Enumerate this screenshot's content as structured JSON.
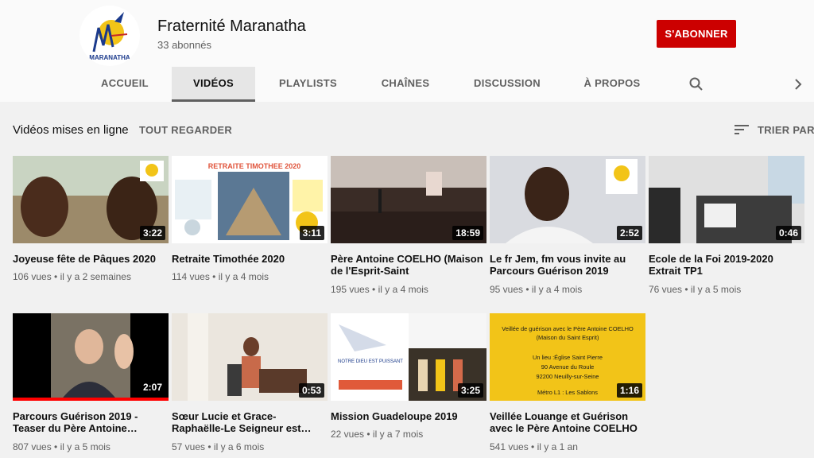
{
  "channel": {
    "name": "Fraternité Maranatha",
    "subscribers": "33 abonnés",
    "subscribe_label": "S'ABONNER",
    "logo_text": "MARANATHA"
  },
  "tabs": [
    {
      "label": "ACCUEIL"
    },
    {
      "label": "VIDÉOS"
    },
    {
      "label": "PLAYLISTS"
    },
    {
      "label": "CHAÎNES"
    },
    {
      "label": "DISCUSSION"
    },
    {
      "label": "À PROPOS"
    }
  ],
  "icons": {
    "search": "search-icon",
    "next": "chevron-right-icon",
    "sort": "sort-icon"
  },
  "section": {
    "title": "Vidéos mises en ligne",
    "play_all": "TOUT REGARDER",
    "sort_label": "TRIER PAR"
  },
  "colors": {
    "subscribe": "#cc0000",
    "progress": "#ff0000"
  },
  "videos": [
    {
      "title": "Joyeuse fête de Pâques 2020",
      "duration": "3:22",
      "views": "106 vues",
      "age": "il y a 2 semaines"
    },
    {
      "title": "Retraite Timothée 2020",
      "duration": "3:11",
      "views": "114 vues",
      "age": "il y a 4 mois",
      "thumb_text": "RETRAITE TIMOTHEE 2020"
    },
    {
      "title": "Père Antoine COELHO (Maison de l'Esprit-Saint",
      "duration": "18:59",
      "views": "195 vues",
      "age": "il y a 4 mois"
    },
    {
      "title": "Le fr Jem, fm vous invite au Parcours Guérison 2019",
      "duration": "2:52",
      "views": "95 vues",
      "age": "il y a 4 mois"
    },
    {
      "title": "Ecole de la Foi 2019-2020 Extrait TP1",
      "duration": "0:46",
      "views": "76 vues",
      "age": "il y a 5 mois"
    },
    {
      "title": "Parcours Guérison 2019 - Teaser du Père Antoine…",
      "duration": "2:07",
      "views": "807 vues",
      "age": "il y a 5 mois",
      "watched_fraction": 1.0
    },
    {
      "title": "Sœur Lucie et Grace-Raphaëlle-Le Seigneur est…",
      "duration": "0:53",
      "views": "57 vues",
      "age": "il y a 6 mois"
    },
    {
      "title": "Mission Guadeloupe 2019",
      "duration": "3:25",
      "views": "22 vues",
      "age": "il y a 7 mois",
      "thumb_text": "NOTRE DIEU EST PUISSANT"
    },
    {
      "title": "Veillée Louange et Guérison avec le Père Antoine COELHO",
      "duration": "1:16",
      "views": "541 vues",
      "age": "il y a 1 an",
      "thumb_lines": [
        "Veillée de guérison avec le Père Antoine COELHO",
        "(Maison du Saint Esprit)",
        "Un lieu :Église Saint Pierre",
        "90 Avenue du Roule",
        "92200 Neuilly-sur-Seine",
        "Métro L1 : Les Sablons"
      ]
    }
  ]
}
